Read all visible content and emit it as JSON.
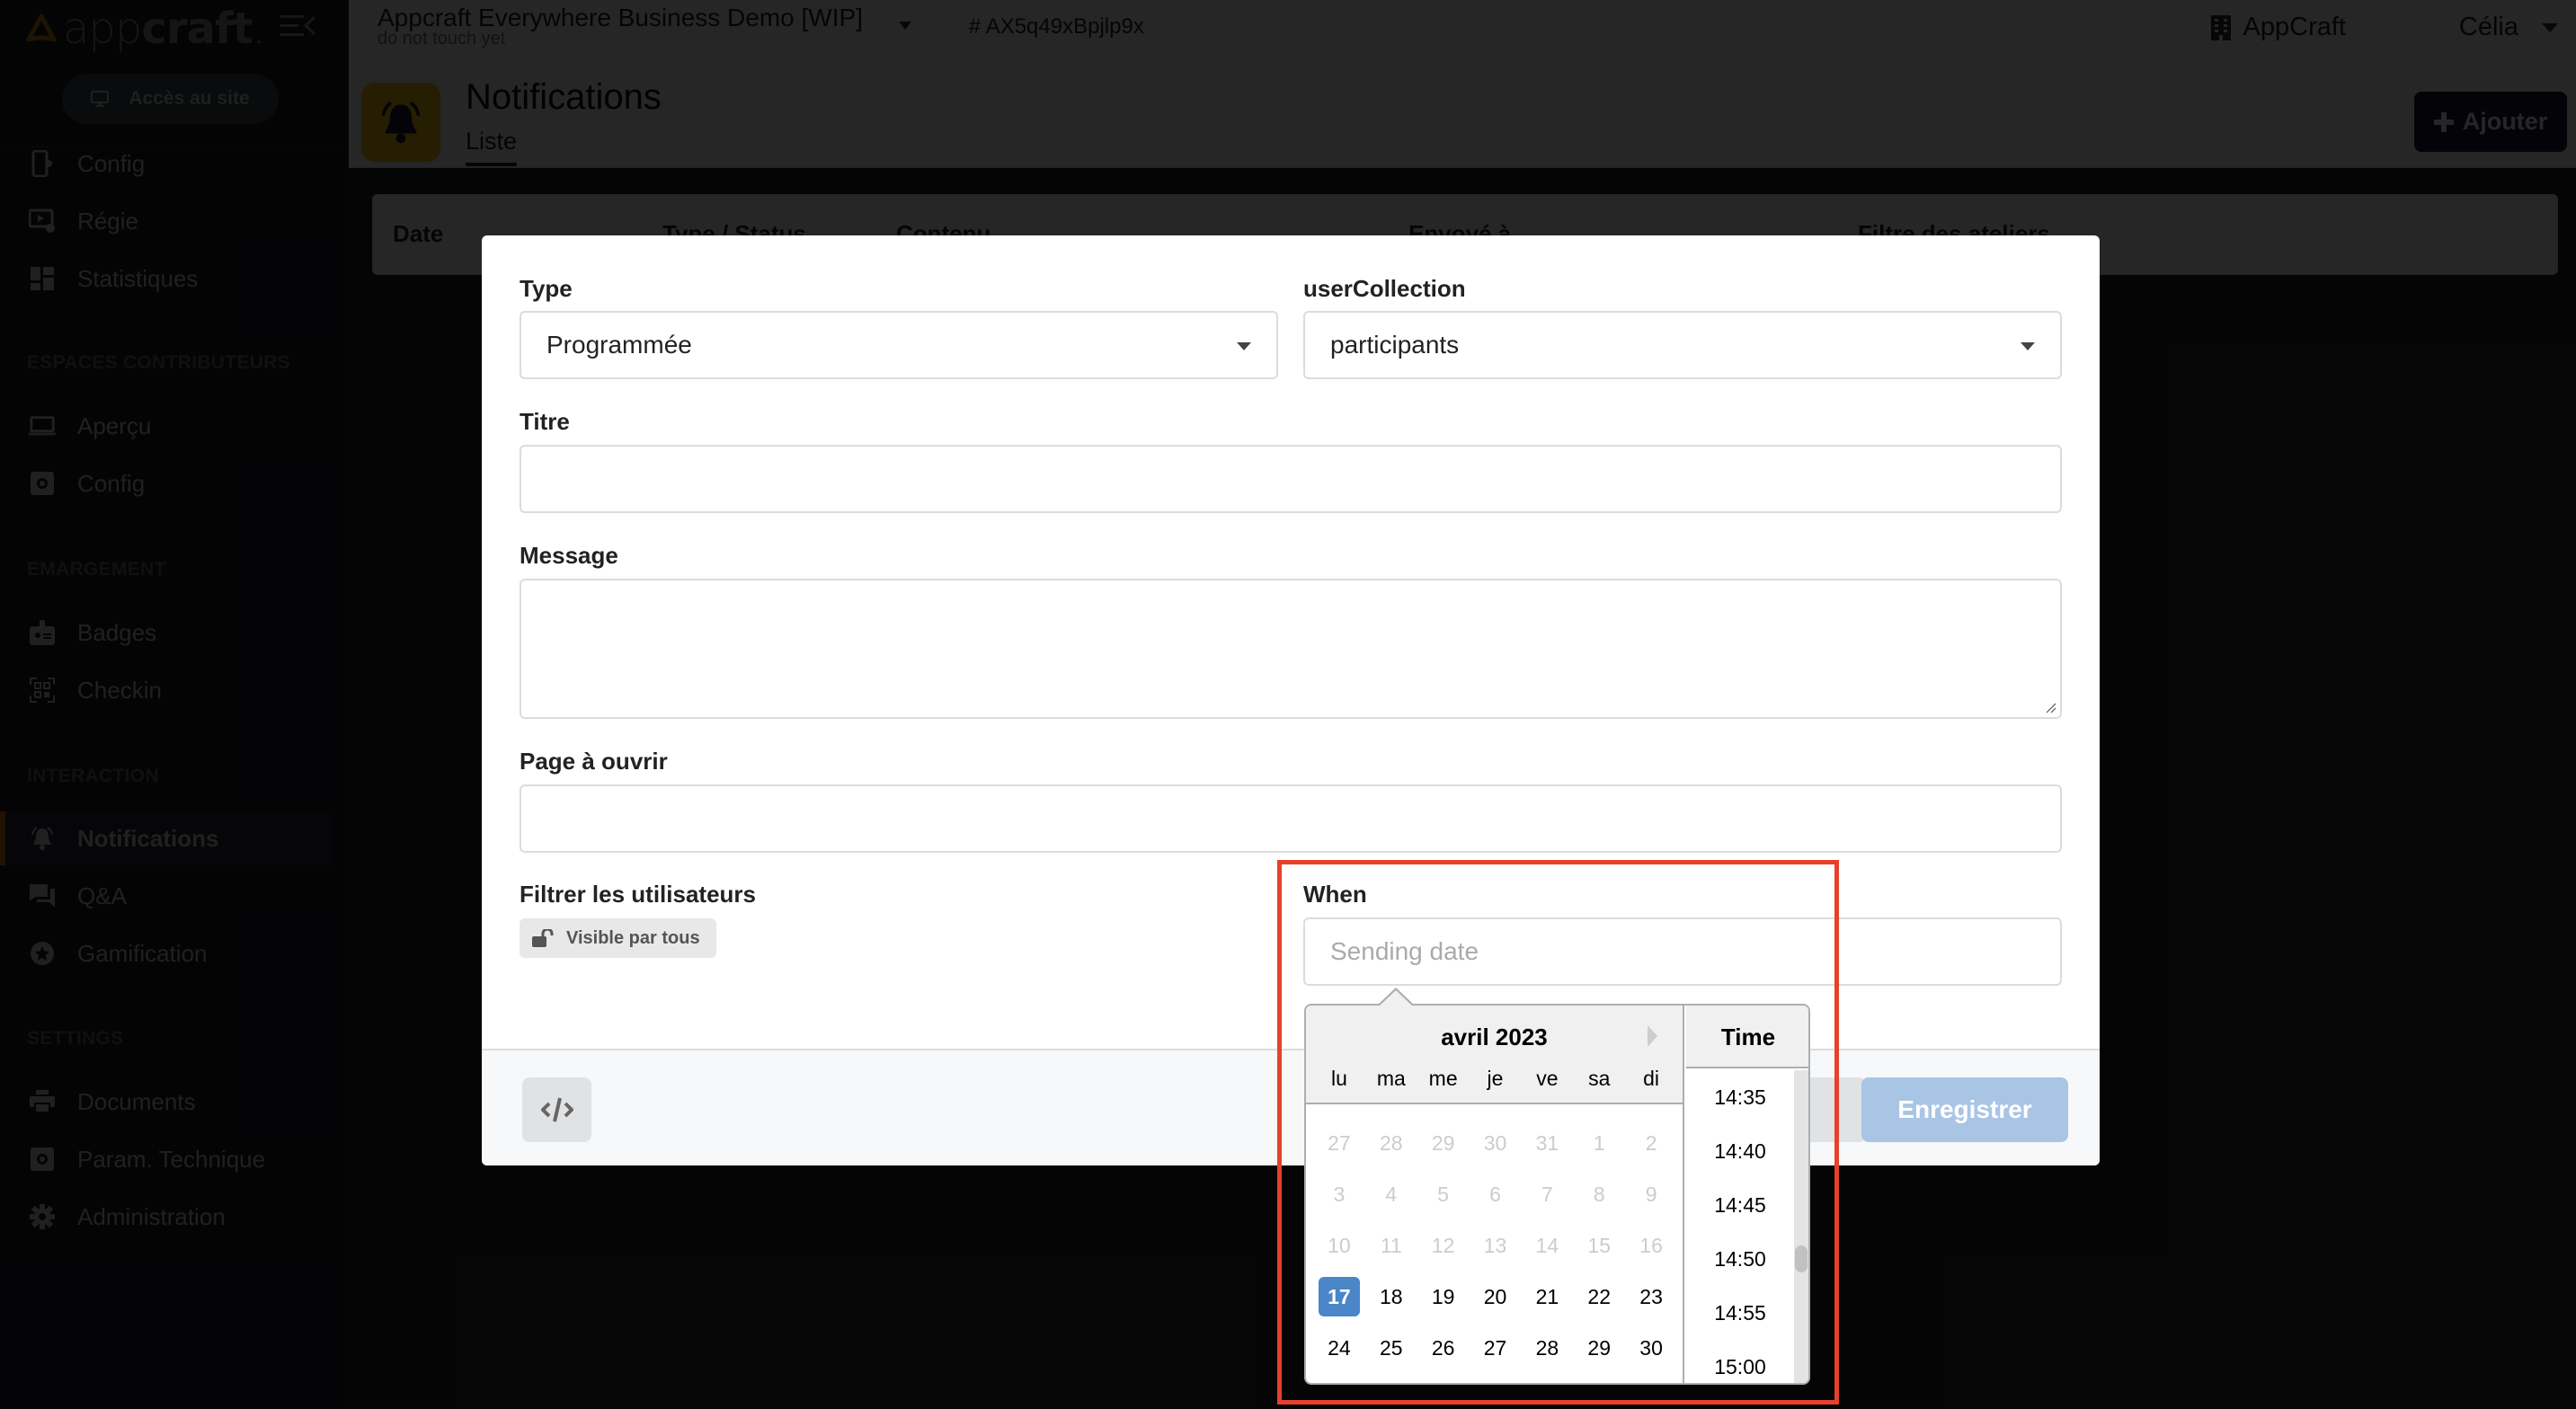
{
  "brand": {
    "name_light": "app",
    "name_bold": "craft",
    "dot": ".",
    "accent": "#f08a24"
  },
  "sidebar": {
    "site_button": "Accès au site",
    "items_top": [
      {
        "label": "Config",
        "icon": "mobile-gear-icon"
      },
      {
        "label": "Régie",
        "icon": "video-gear-icon"
      },
      {
        "label": "Statistiques",
        "icon": "dashboard-icon"
      }
    ],
    "sections": [
      {
        "heading": "ESPACES CONTRIBUTEURS",
        "items": [
          {
            "label": "Aperçu",
            "icon": "laptop-icon"
          },
          {
            "label": "Config",
            "icon": "gear-box-icon"
          }
        ]
      },
      {
        "heading": "EMARGEMENT",
        "items": [
          {
            "label": "Badges",
            "icon": "badge-icon"
          },
          {
            "label": "Checkin",
            "icon": "qr-code-icon"
          }
        ]
      },
      {
        "heading": "INTERACTION",
        "items": [
          {
            "label": "Notifications",
            "icon": "bell-icon",
            "active": true
          },
          {
            "label": "Q&A",
            "icon": "chat-icon"
          },
          {
            "label": "Gamification",
            "icon": "star-icon"
          }
        ]
      },
      {
        "heading": "SETTINGS",
        "items": [
          {
            "label": "Documents",
            "icon": "printer-icon"
          },
          {
            "label": "Param. Technique",
            "icon": "gear-box-icon"
          },
          {
            "label": "Administration",
            "icon": "gear-icon"
          }
        ]
      }
    ]
  },
  "topbar": {
    "project_title": "Appcraft Everywhere Business Demo [WIP]",
    "project_subtitle": "do not touch yet",
    "project_id": "# AX5q49xBpjlp9x",
    "org": "AppCraft",
    "user": "Célia"
  },
  "page": {
    "title": "Notifications",
    "tab": "Liste",
    "add_button": "Ajouter",
    "table_headers": [
      "Date",
      "Type / Status",
      "Contenu",
      "Envoyé à",
      "Filtre des ateliers"
    ]
  },
  "modal": {
    "type": {
      "label": "Type",
      "value": "Programmée"
    },
    "user_collection": {
      "label": "userCollection",
      "value": "participants"
    },
    "titre": {
      "label": "Titre",
      "value": ""
    },
    "message": {
      "label": "Message",
      "value": ""
    },
    "page": {
      "label": "Page à ouvrir",
      "value": ""
    },
    "filter": {
      "label": "Filtrer les utilisateurs",
      "chip": "Visible par tous"
    },
    "when": {
      "label": "When",
      "placeholder": "Sending date",
      "value": ""
    },
    "footer": {
      "save": "Enregistrer"
    }
  },
  "datepicker": {
    "month": "avril 2023",
    "weekdays": [
      "lu",
      "ma",
      "me",
      "je",
      "ve",
      "sa",
      "di"
    ],
    "weeks": [
      [
        {
          "d": "27",
          "m": true
        },
        {
          "d": "28",
          "m": true
        },
        {
          "d": "29",
          "m": true
        },
        {
          "d": "30",
          "m": true
        },
        {
          "d": "31",
          "m": true
        },
        {
          "d": "1",
          "m": true
        },
        {
          "d": "2",
          "m": true
        }
      ],
      [
        {
          "d": "3",
          "m": true
        },
        {
          "d": "4",
          "m": true
        },
        {
          "d": "5",
          "m": true
        },
        {
          "d": "6",
          "m": true
        },
        {
          "d": "7",
          "m": true
        },
        {
          "d": "8",
          "m": true
        },
        {
          "d": "9",
          "m": true
        }
      ],
      [
        {
          "d": "10",
          "m": true
        },
        {
          "d": "11",
          "m": true
        },
        {
          "d": "12",
          "m": true
        },
        {
          "d": "13",
          "m": true
        },
        {
          "d": "14",
          "m": true
        },
        {
          "d": "15",
          "m": true
        },
        {
          "d": "16",
          "m": true
        }
      ],
      [
        {
          "d": "17",
          "sel": true
        },
        {
          "d": "18"
        },
        {
          "d": "19"
        },
        {
          "d": "20"
        },
        {
          "d": "21"
        },
        {
          "d": "22"
        },
        {
          "d": "23"
        }
      ],
      [
        {
          "d": "24"
        },
        {
          "d": "25"
        },
        {
          "d": "26"
        },
        {
          "d": "27"
        },
        {
          "d": "28"
        },
        {
          "d": "29"
        },
        {
          "d": "30"
        }
      ]
    ],
    "time_label": "Time",
    "times": [
      "14:35",
      "14:40",
      "14:45",
      "14:50",
      "14:55",
      "15:00"
    ],
    "selected_color": "#4a86c8"
  },
  "annotation": {
    "color": "#e6412a"
  }
}
